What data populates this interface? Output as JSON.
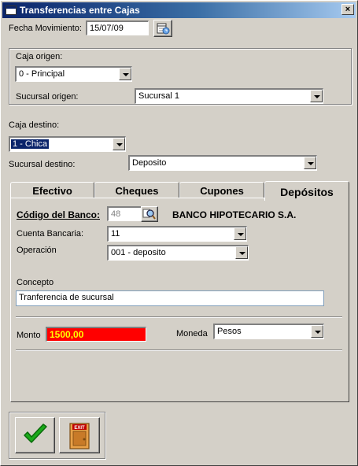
{
  "window": {
    "title": "Transferencias entre Cajas",
    "close_glyph": "×"
  },
  "fecha": {
    "label": "Fecha Movimiento:",
    "value": "15/07/09",
    "calendar_icon": "calendar-icon"
  },
  "origen": {
    "caja_label": "Caja origen:",
    "caja_value": "0 - Principal",
    "sucursal_label": "Sucursal origen:",
    "sucursal_value": "Sucursal 1"
  },
  "destino": {
    "caja_label": "Caja destino:",
    "caja_value": "1 - Chica",
    "sucursal_label": "Sucursal destino:",
    "sucursal_value": "Deposito"
  },
  "tabs": [
    {
      "label": "Efectivo"
    },
    {
      "label": "Cheques"
    },
    {
      "label": "Cupones"
    },
    {
      "label": "Depósitos"
    }
  ],
  "depositos": {
    "banco_label": "Código del Banco:",
    "banco_codigo": "48",
    "banco_nombre": "BANCO HIPOTECARIO S.A.",
    "cuenta_label": "Cuenta Bancaria:",
    "cuenta_value": "11",
    "operacion_label": "Operación",
    "operacion_value": "001 - deposito",
    "concepto_label": "Concepto",
    "concepto_value": "Tranferencia de sucursal",
    "monto_label": "Monto",
    "monto_value": "1500,00",
    "moneda_label": "Moneda",
    "moneda_value": "Pesos"
  },
  "footer": {
    "ok_icon": "checkmark-icon",
    "exit_icon": "exit-door-icon",
    "exit_text": "EXIT"
  },
  "colors": {
    "titlebar": "#0a246a",
    "monto_bg": "#ff0000",
    "monto_fg": "#ffff00",
    "check": "#1aaa1a"
  }
}
